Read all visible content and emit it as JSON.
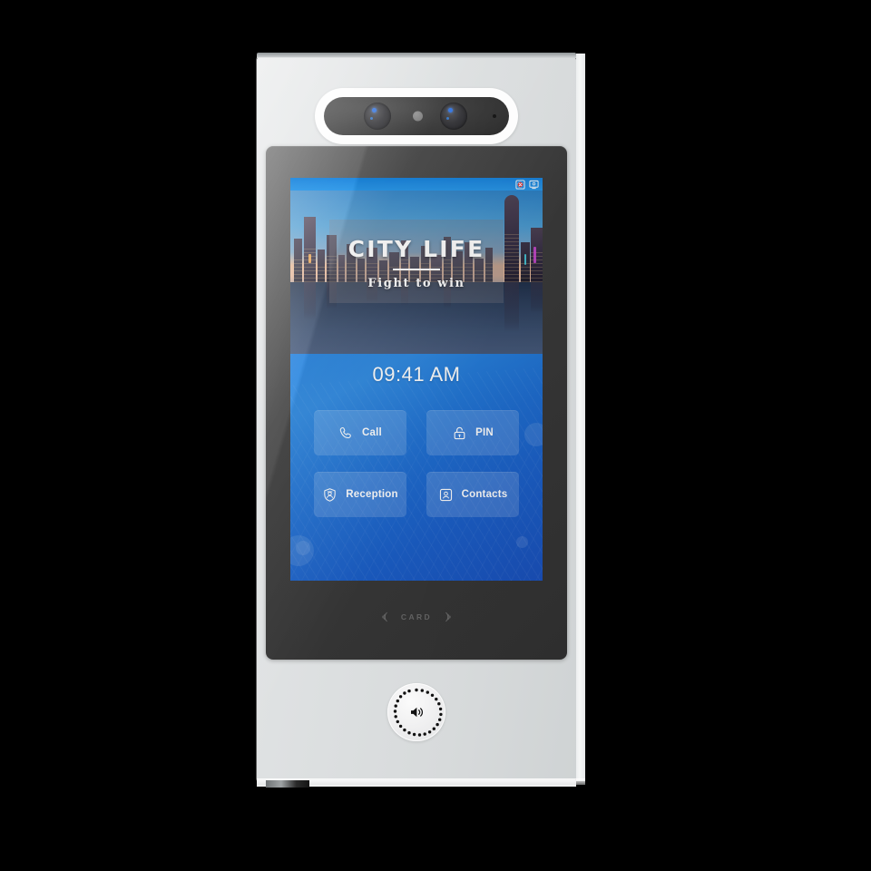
{
  "device": {
    "name": "face-recognition-door-station",
    "camera_module": {
      "lens_left": "camera-lens",
      "lens_right": "camera-lens",
      "ir_sensor": "ir-sensor",
      "indicator": "indicator-dot"
    },
    "speaker": {
      "label": "speaker-grille",
      "icon": "speaker-icon"
    }
  },
  "screen": {
    "statusbar": {
      "icons": [
        {
          "name": "network-disconnected-icon",
          "label": "Network Disconnected"
        },
        {
          "name": "monitor-icon",
          "label": "Monitor"
        }
      ]
    },
    "banner": {
      "title": "CITY LIFE",
      "subtitle": "Fight to win"
    },
    "clock": "09:41 AM",
    "tiles": [
      {
        "label": "Call",
        "icon": "phone-icon"
      },
      {
        "label": "PIN",
        "icon": "unlock-icon"
      },
      {
        "label": "Reception",
        "icon": "guard-badge-icon"
      },
      {
        "label": "Contacts",
        "icon": "contacts-icon"
      }
    ]
  },
  "card_reader": {
    "label": "CARD",
    "left_icon": "rfid-wave-left-icon",
    "right_icon": "rfid-wave-right-icon"
  },
  "colors": {
    "accent_blue": "#1f7fdd",
    "status_blue": "#2a97e8",
    "tile_fill": "rgba(255,255,255,0.155)",
    "body_gray": "#dcdfe0",
    "bezel_dark": "#3c3c3c"
  }
}
